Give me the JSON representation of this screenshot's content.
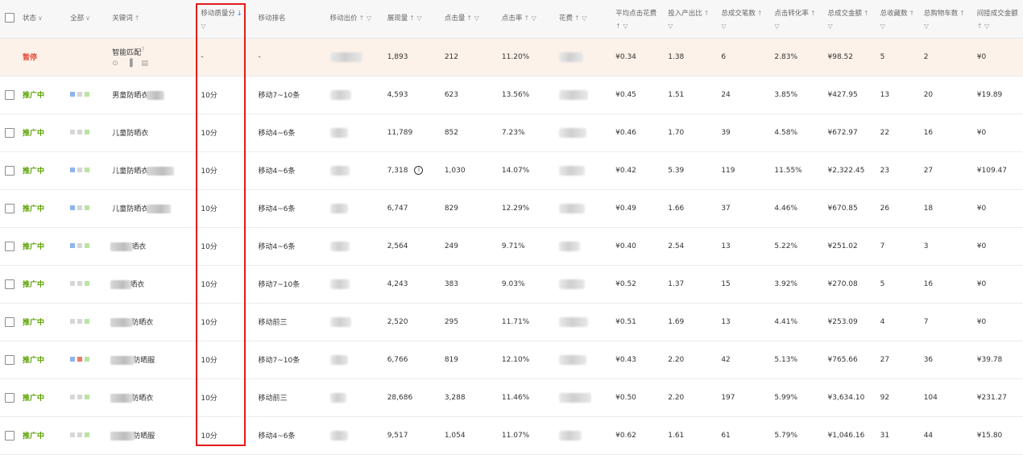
{
  "columns": [
    {
      "label": "状态",
      "icon": "chevron-down-icon",
      "sub": ""
    },
    {
      "label": "全部",
      "icon": "chevron-down-icon",
      "sub": ""
    },
    {
      "label": "关键词",
      "icon": "sort-icon",
      "sub": ""
    },
    {
      "label": "移动质量分",
      "icon": "sort-desc-icon",
      "sub": "filter-icon"
    },
    {
      "label": "移动排名",
      "icon": "",
      "sub": ""
    },
    {
      "label": "移动出价",
      "icon": "sort-filter-icon",
      "sub": ""
    },
    {
      "label": "展现量",
      "icon": "sort-filter-icon",
      "sub": ""
    },
    {
      "label": "点击量",
      "icon": "sort-filter-icon",
      "sub": ""
    },
    {
      "label": "点击率",
      "icon": "sort-filter-icon",
      "sub": ""
    },
    {
      "label": "花费",
      "icon": "sort-filter-icon",
      "sub": ""
    },
    {
      "label": "平均点击花费",
      "icon": "",
      "sub": "sort-filter-icon"
    },
    {
      "label": "投入产出比",
      "icon": "sort-icon",
      "sub": "filter-icon"
    },
    {
      "label": "总成交笔数",
      "icon": "sort-icon",
      "sub": "filter-icon"
    },
    {
      "label": "点击转化率",
      "icon": "sort-icon",
      "sub": "filter-icon"
    },
    {
      "label": "总成交金额",
      "icon": "sort-icon",
      "sub": "filter-icon"
    },
    {
      "label": "总收藏数",
      "icon": "sort-icon",
      "sub": "filter-icon"
    },
    {
      "label": "总购物车数",
      "icon": "sort-icon",
      "sub": "filter-icon"
    },
    {
      "label": "间接成交金额",
      "icon": "",
      "sub": "sort-filter-icon"
    }
  ],
  "icons": {
    "chevron": "∨",
    "sort": "↑",
    "sort_desc": "↓",
    "filter": "▽",
    "sort_filter": "↑ ▽",
    "help": "?",
    "smart_tools": "⊙ ▐ ▤",
    "info": "i"
  },
  "colors": {
    "promoting": "#5aa000",
    "paused": "#e34c3c",
    "highlight_box": "#e41b1b",
    "sort_active": "#1f7fd9"
  },
  "rows": [
    {
      "status": "暂停",
      "kw": "智能匹配",
      "kw_blur": false,
      "smart": true,
      "quality": "-",
      "rank": "-",
      "impressions": "1,893",
      "clicks": "212",
      "ctr": "11.20%",
      "cpc": "¥0.34",
      "roi": "1.38",
      "orders": "6",
      "cvr": "2.83%",
      "gmv": "¥98.52",
      "favs": "5",
      "carts": "2",
      "indirect": "¥0"
    },
    {
      "status": "推广中",
      "kw": "男童防晒衣",
      "kw_blur": true,
      "quality": "10分",
      "rank": "移动7~10条",
      "impressions": "4,593",
      "clicks": "623",
      "ctr": "13.56%",
      "cpc": "¥0.45",
      "roi": "1.51",
      "orders": "24",
      "cvr": "3.85%",
      "gmv": "¥427.95",
      "favs": "13",
      "carts": "20",
      "indirect": "¥19.89"
    },
    {
      "status": "推广中",
      "kw": "儿童防晒衣",
      "kw_blur": false,
      "quality": "10分",
      "rank": "移动4~6条",
      "impressions": "11,789",
      "clicks": "852",
      "ctr": "7.23%",
      "cpc": "¥0.46",
      "roi": "1.70",
      "orders": "39",
      "cvr": "4.58%",
      "gmv": "¥672.97",
      "favs": "22",
      "carts": "16",
      "indirect": "¥0"
    },
    {
      "status": "推广中",
      "kw": "儿童防晒衣",
      "kw_blur": true,
      "quality": "10分",
      "rank": "移动4~6条",
      "impressions": "7,318",
      "info": true,
      "clicks": "1,030",
      "ctr": "14.07%",
      "cpc": "¥0.42",
      "roi": "5.39",
      "orders": "119",
      "cvr": "11.55%",
      "gmv": "¥2,322.45",
      "favs": "23",
      "carts": "27",
      "indirect": "¥109.47"
    },
    {
      "status": "推广中",
      "kw": "儿童防晒衣",
      "kw_blur": true,
      "quality": "10分",
      "rank": "移动4~6条",
      "impressions": "6,747",
      "clicks": "829",
      "ctr": "12.29%",
      "cpc": "¥0.49",
      "roi": "1.66",
      "orders": "37",
      "cvr": "4.46%",
      "gmv": "¥670.85",
      "favs": "26",
      "carts": "18",
      "indirect": "¥0"
    },
    {
      "status": "推广中",
      "kw": "晒衣",
      "kw_blur": true,
      "kw_blur_first": true,
      "quality": "10分",
      "rank": "移动4~6条",
      "impressions": "2,564",
      "clicks": "249",
      "ctr": "9.71%",
      "cpc": "¥0.40",
      "roi": "2.54",
      "orders": "13",
      "cvr": "5.22%",
      "gmv": "¥251.02",
      "favs": "7",
      "carts": "3",
      "indirect": "¥0"
    },
    {
      "status": "推广中",
      "kw": "晒衣",
      "kw_blur": true,
      "kw_blur_first": true,
      "quality": "10分",
      "rank": "移动7~10条",
      "impressions": "4,243",
      "clicks": "383",
      "ctr": "9.03%",
      "cpc": "¥0.52",
      "roi": "1.37",
      "orders": "15",
      "cvr": "3.92%",
      "gmv": "¥270.08",
      "favs": "5",
      "carts": "16",
      "indirect": "¥0"
    },
    {
      "status": "推广中",
      "kw": "防晒衣",
      "kw_blur": true,
      "kw_blur_first": true,
      "quality": "10分",
      "rank": "移动前三",
      "impressions": "2,520",
      "clicks": "295",
      "ctr": "11.71%",
      "cpc": "¥0.51",
      "roi": "1.69",
      "orders": "13",
      "cvr": "4.41%",
      "gmv": "¥253.09",
      "favs": "4",
      "carts": "7",
      "indirect": "¥0"
    },
    {
      "status": "推广中",
      "kw": "防晒服",
      "kw_blur": true,
      "kw_blur_first": true,
      "quality": "10分",
      "rank": "移动7~10条",
      "impressions": "6,766",
      "clicks": "819",
      "ctr": "12.10%",
      "cpc": "¥0.43",
      "roi": "2.20",
      "orders": "42",
      "cvr": "5.13%",
      "gmv": "¥765.66",
      "favs": "27",
      "carts": "36",
      "indirect": "¥39.78"
    },
    {
      "status": "推广中",
      "kw": "防晒衣",
      "kw_blur": true,
      "kw_blur_first": true,
      "quality": "10分",
      "rank": "移动前三",
      "impressions": "28,686",
      "clicks": "3,288",
      "ctr": "11.46%",
      "cpc": "¥0.50",
      "roi": "2.20",
      "orders": "197",
      "cvr": "5.99%",
      "gmv": "¥3,634.10",
      "favs": "92",
      "carts": "104",
      "indirect": "¥231.27"
    },
    {
      "status": "推广中",
      "kw": "防晒服",
      "kw_blur": true,
      "kw_blur_first": true,
      "quality": "10分",
      "rank": "移动4~6条",
      "impressions": "9,517",
      "clicks": "1,054",
      "ctr": "11.07%",
      "cpc": "¥0.62",
      "roi": "1.61",
      "orders": "61",
      "cvr": "5.79%",
      "gmv": "¥1,046.16",
      "favs": "31",
      "carts": "44",
      "indirect": "¥15.80"
    }
  ]
}
